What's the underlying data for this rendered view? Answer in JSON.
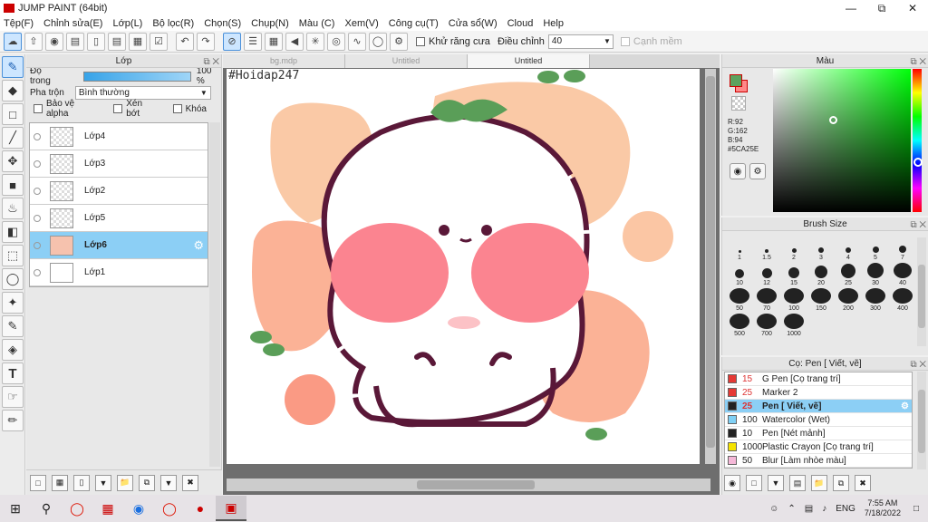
{
  "app": {
    "title": "JUMP PAINT (64bit)"
  },
  "menu": [
    "Tệp(F)",
    "Chỉnh sửa(E)",
    "Lớp(L)",
    "Bộ lọc(R)",
    "Chọn(S)",
    "Chụp(N)",
    "Màu (C)",
    "Xem(V)",
    "Công cụ(T)",
    "Cửa sổ(W)",
    "Cloud",
    "Help"
  ],
  "toolbar": {
    "antialias_label": "Khử răng cưa",
    "adjust_label": "Điều chỉnh",
    "adjust_value": "40",
    "edge_label": "Cạnh mềm"
  },
  "layer_panel": {
    "title": "Lớp",
    "opacity_label": "Độ trong",
    "opacity_value": "100 %",
    "blend_label": "Pha trộn",
    "blend_value": "Bình thường",
    "protect_alpha": "Bảo vệ alpha",
    "clip": "Xén bớt",
    "lock": "Khóa",
    "layers": [
      {
        "name": "Lớp4"
      },
      {
        "name": "Lớp3"
      },
      {
        "name": "Lớp2"
      },
      {
        "name": "Lớp5"
      },
      {
        "name": "Lớp6",
        "selected": true
      },
      {
        "name": "Lớp1"
      }
    ]
  },
  "canvas": {
    "tabs": [
      "bg.mdp",
      "Untitled",
      "Untitled"
    ],
    "watermark": "#Hoidap247"
  },
  "color_panel": {
    "title": "Màu",
    "r": "R:92",
    "g": "G:162",
    "b": "B:94",
    "hex": "#5CA25E",
    "main": "#5CA25E"
  },
  "brush_panel": {
    "title": "Brush Size",
    "sizes": [
      "1",
      "1.5",
      "2",
      "3",
      "4",
      "5",
      "7",
      "10",
      "12",
      "15",
      "20",
      "25",
      "30",
      "40",
      "50",
      "70",
      "100",
      "150",
      "200",
      "300",
      "400",
      "500",
      "700",
      "1000"
    ]
  },
  "tool_panel": {
    "title": "Cọ: Pen [ Viết, vẽ]",
    "items": [
      {
        "size": "15",
        "name": "G Pen [Cọ trang trí]",
        "color": "#e53935"
      },
      {
        "size": "25",
        "name": "Marker 2",
        "color": "#e53935"
      },
      {
        "size": "25",
        "name": "Pen [ Viết, vẽ]",
        "color": "#222222",
        "selected": true
      },
      {
        "size": "100",
        "name": "Watercolor (Wet)",
        "color": "#7fd0f5"
      },
      {
        "size": "10",
        "name": "Pen [Nét mảnh]",
        "color": "#222222"
      },
      {
        "size": "1000",
        "name": "Plastic Crayon [Cọ trang trí]",
        "color": "#f5e300"
      },
      {
        "size": "50",
        "name": "Blur [Làm nhòe màu]",
        "color": "#f5b8d8"
      }
    ]
  },
  "taskbar": {
    "lang": "ENG",
    "time": "7:55 AM",
    "date": "7/18/2022"
  }
}
